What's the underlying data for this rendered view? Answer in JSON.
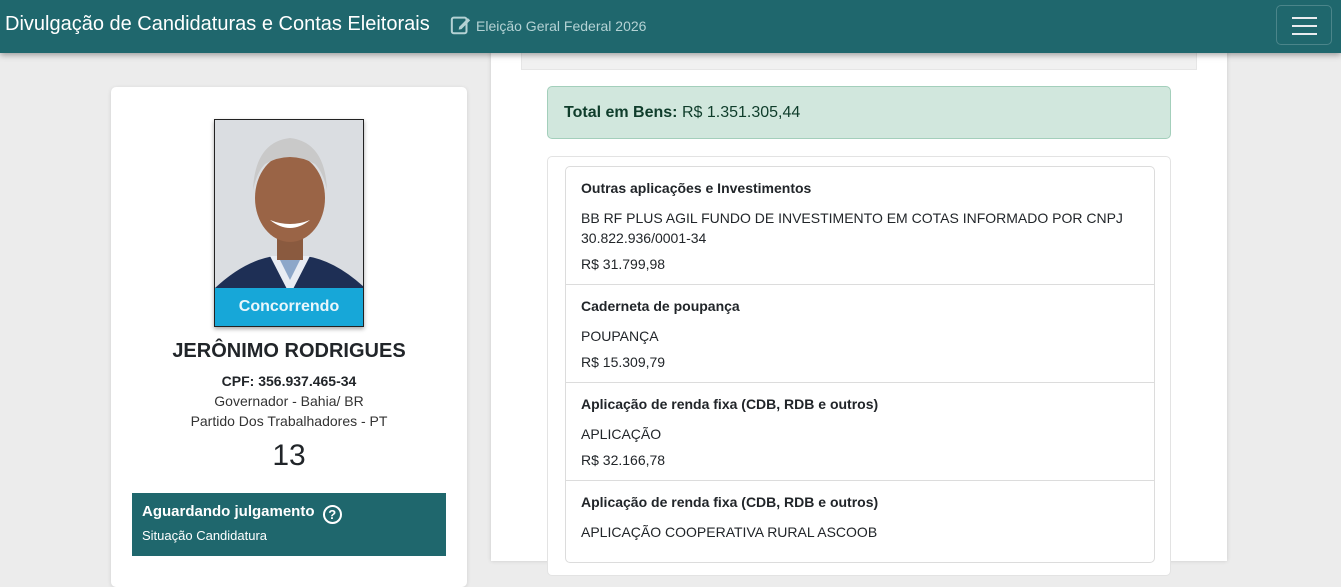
{
  "header": {
    "title": "Divulgação de Candidaturas e Contas Eleitorais",
    "election": "Eleição Geral Federal 2026"
  },
  "candidate": {
    "status_ribbon": "Concorrendo",
    "name": "JERÔNIMO RODRIGUES",
    "cpf": "CPF: 356.937.465-34",
    "cargo": "Governador - Bahia/ BR",
    "partido": "Partido Dos Trabalhadores - PT",
    "numero": "13",
    "judgement_title": "Aguardando julgamento",
    "judgement_sub": "Situação Candidatura",
    "help_glyph": "?"
  },
  "assets": {
    "total_label": "Total em Bens:",
    "total_value": "R$ 1.351.305,44",
    "items": [
      {
        "type": "Outras aplicações e Investimentos",
        "description": "BB RF PLUS AGIL FUNDO DE INVESTIMENTO EM COTAS INFORMADO POR CNPJ 30.822.936/0001-34",
        "value": "R$ 31.799,98"
      },
      {
        "type": "Caderneta de poupança",
        "description": "POUPANÇA",
        "value": "R$ 15.309,79"
      },
      {
        "type": "Aplicação de renda fixa (CDB, RDB e outros)",
        "description": "APLICAÇÃO",
        "value": "R$ 32.166,78"
      },
      {
        "type": "Aplicação de renda fixa (CDB, RDB e outros)",
        "description": "APLICAÇÃO COOPERATIVA RURAL ASCOOB",
        "value": ""
      }
    ]
  },
  "colors": {
    "navbar": "#1f676d",
    "ribbon": "#17a7d8",
    "total_bg": "#d1e7dd"
  },
  "icons": {
    "edit": "edit-icon",
    "menu": "menu-icon",
    "help": "help-icon"
  }
}
